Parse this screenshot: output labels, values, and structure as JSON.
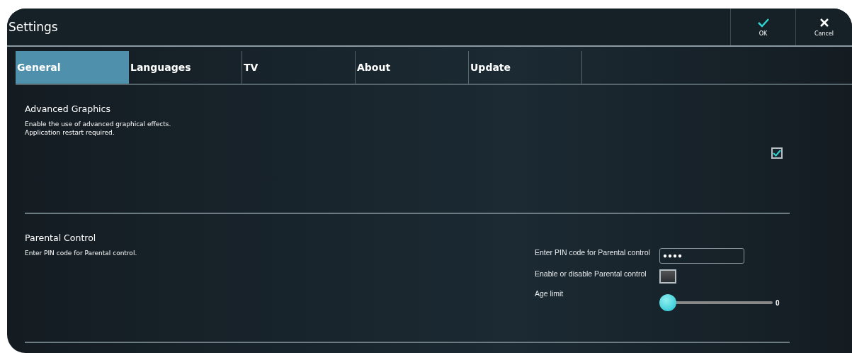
{
  "window": {
    "title": "Settings"
  },
  "actions": [
    {
      "kind": "ok",
      "label": "OK"
    },
    {
      "kind": "cancel",
      "label": "Cancel"
    }
  ],
  "tabs": [
    {
      "label": "General",
      "selected": true
    },
    {
      "label": "Languages",
      "selected": false
    },
    {
      "label": "TV",
      "selected": false
    },
    {
      "label": "About",
      "selected": false
    },
    {
      "label": "Update",
      "selected": false
    }
  ],
  "sections": [
    {
      "title": "Advanced Graphics",
      "description": "Enable the use of advanced graphical effects. Application restart required.",
      "controls": [
        {
          "kind": "checkbox",
          "checked": true
        }
      ]
    },
    {
      "title": "Parental Control",
      "description": "Enter PIN code for Parental control.",
      "controls": [
        {
          "kind": "pin",
          "label": "Enter PIN code for Parental control",
          "value": "●●●●"
        },
        {
          "kind": "checkbox",
          "label": "Enable or disable Parental control",
          "checked": false
        },
        {
          "kind": "slider",
          "label": "Age limit",
          "level": 0,
          "reading": "0"
        }
      ]
    }
  ]
}
